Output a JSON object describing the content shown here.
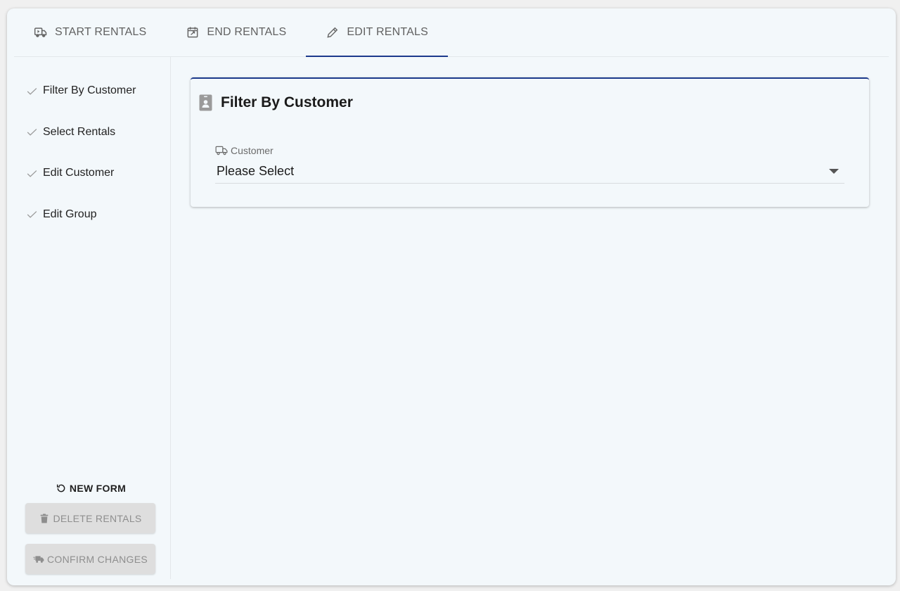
{
  "tabs": [
    {
      "label": "START RENTALS",
      "icon": "truck-play-icon",
      "active": false
    },
    {
      "label": "END RENTALS",
      "icon": "calendar-check-icon",
      "active": false
    },
    {
      "label": "EDIT RENTALS",
      "icon": "pencil-icon",
      "active": true
    }
  ],
  "sidebar": {
    "steps": [
      {
        "label": "Filter By Customer",
        "icon": "check-icon"
      },
      {
        "label": "Select Rentals",
        "icon": "check-icon"
      },
      {
        "label": "Edit Customer",
        "icon": "check-icon"
      },
      {
        "label": "Edit Group",
        "icon": "check-icon"
      }
    ],
    "new_form_label": "NEW FORM",
    "delete_label": "DELETE RENTALS",
    "confirm_label": "CONFIRM CHANGES"
  },
  "card": {
    "title": "Filter By Customer",
    "icon": "badge-icon",
    "customer_field": {
      "label": "Customer",
      "icon": "truck-icon",
      "value": "Please Select"
    }
  },
  "colors": {
    "accent": "#1c3a8c",
    "background": "#f3f8fb",
    "disabled_button": "#dedede"
  }
}
